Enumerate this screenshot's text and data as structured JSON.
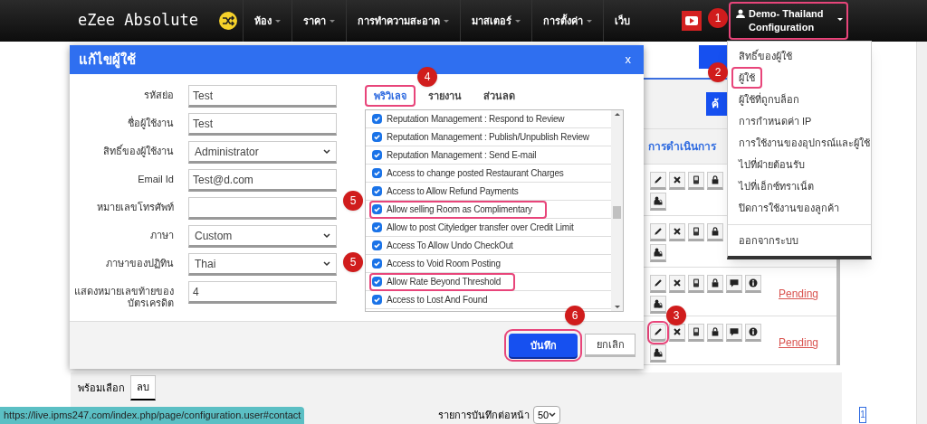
{
  "navbar": {
    "logo": "eZee Absolute",
    "menu": [
      {
        "label": "ห้อง",
        "dropdown": true
      },
      {
        "label": "ราคา",
        "dropdown": true
      },
      {
        "label": "การทำความสะอาด",
        "dropdown": true
      },
      {
        "label": "มาสเตอร์",
        "dropdown": true
      },
      {
        "label": "การตั้งค่า",
        "dropdown": true
      },
      {
        "label": "เว็บ",
        "dropdown": false
      }
    ],
    "user": {
      "line1": "Demo- Thailand",
      "line2": "Configuration",
      "highlighted": true
    }
  },
  "user_menu": {
    "items": [
      {
        "label": "สิทธิ์ของผู้ใช้",
        "highlighted": false
      },
      {
        "label": "ผู้ใช้",
        "highlighted": true
      },
      {
        "label": "ผู้ใช้ที่ถูกบล็อก",
        "highlighted": false
      },
      {
        "label": "การกำหนดค่า IP",
        "highlighted": false
      },
      {
        "label": "การใช้งานของอุปกรณ์และผู้ใช้",
        "highlighted": false
      },
      {
        "label": "ไปที่ฝ่ายต้อนรับ",
        "highlighted": false
      },
      {
        "label": "ไปที่เอ็กซ์ทราเน็ต",
        "highlighted": false
      },
      {
        "label": "ปิดการใช้งานของลูกค้า",
        "highlighted": false
      }
    ],
    "logout": "ออกจากระบบ"
  },
  "page": {
    "search_button": "ค้",
    "column_header": "การดำเนินการ",
    "rows": [
      {
        "actions": [
          {
            "kind": "edit"
          },
          {
            "kind": "delete"
          },
          {
            "kind": "device"
          },
          {
            "kind": "lock"
          }
        ],
        "highlighted": false
      },
      {
        "actions": [
          {
            "kind": "edit"
          },
          {
            "kind": "delete"
          },
          {
            "kind": "device"
          },
          {
            "kind": "lock"
          }
        ],
        "highlighted": false
      },
      {
        "actions": [
          {
            "kind": "edit"
          },
          {
            "kind": "delete"
          },
          {
            "kind": "device"
          },
          {
            "kind": "lock"
          },
          {
            "kind": "comment"
          },
          {
            "kind": "info"
          }
        ],
        "status": "Pending",
        "highlighted": false
      },
      {
        "actions": [
          {
            "kind": "edit"
          },
          {
            "kind": "delete"
          },
          {
            "kind": "device"
          },
          {
            "kind": "lock"
          },
          {
            "kind": "comment"
          },
          {
            "kind": "info"
          }
        ],
        "status": "Pending",
        "highlighted": true
      }
    ],
    "bottom_tabs": [
      {
        "label": "พร้อมเลือก",
        "selected": false
      },
      {
        "label": "ลบ",
        "selected": true
      }
    ],
    "per_page_label": "รายการบันทึกต่อหน้า",
    "per_page": "50",
    "page_number": "1"
  },
  "dialog": {
    "title": "แก้ไขผู้ใช้",
    "close": "x",
    "fields": [
      {
        "label": "รหัสย่อ",
        "value": "Test",
        "kind": "text"
      },
      {
        "label": "ชื่อผู้ใช้งาน",
        "value": "Test",
        "kind": "text"
      },
      {
        "label": "สิทธิ์ของผู้ใช้งาน",
        "value": "Administrator",
        "kind": "select"
      },
      {
        "label": "Email Id",
        "value": "Test@d.com",
        "kind": "text"
      },
      {
        "label": "หมายเลขโทรศัพท์",
        "kind": "text"
      },
      {
        "label": "ภาษา",
        "value": "Custom",
        "kind": "select"
      },
      {
        "label": "ภาษาของปฏิทิน",
        "value": "Thai",
        "kind": "select"
      },
      {
        "label": "แสดงหมายเลขท้ายของบัตรเครดิต",
        "value": "4",
        "kind": "text"
      }
    ],
    "tabs": [
      {
        "label": "พริวิเลจ",
        "selected": true,
        "highlighted": true
      },
      {
        "label": "รายงาน",
        "selected": false,
        "highlighted": false
      },
      {
        "label": "ส่วนลด",
        "selected": false,
        "highlighted": false
      }
    ],
    "privileges": [
      {
        "label": "Reputation Management : Respond to Review",
        "checked": true,
        "highlighted": false
      },
      {
        "label": "Reputation Management : Publish/Unpublish Review",
        "checked": true,
        "highlighted": false
      },
      {
        "label": "Reputation Management : Send E-mail",
        "checked": true,
        "highlighted": false
      },
      {
        "label": "Access to change posted Restaurant Charges",
        "checked": true,
        "highlighted": false
      },
      {
        "label": "Access to Allow Refund Payments",
        "checked": true,
        "highlighted": false
      },
      {
        "label": "Allow selling Room as Complimentary",
        "checked": true,
        "highlighted": true
      },
      {
        "label": "Allow to post Cityledger transfer over Credit Limit",
        "checked": true,
        "highlighted": false
      },
      {
        "label": "Access To Allow Undo CheckOut",
        "checked": true,
        "highlighted": false
      },
      {
        "label": "Access to Void Room Posting",
        "checked": true,
        "highlighted": false
      },
      {
        "label": "Allow Rate Beyond Threshold",
        "checked": true,
        "highlighted": true
      },
      {
        "label": "Access to Lost And Found",
        "checked": true,
        "highlighted": false
      }
    ],
    "save": {
      "label": "บันทึก",
      "highlighted": true
    },
    "cancel": "ยกเลิก"
  },
  "annotations": [
    "1",
    "2",
    "3",
    "4",
    "5",
    "5",
    "6"
  ],
  "status_url": "https://live.ipms247.com/index.php/page/configuration.user#contact"
}
